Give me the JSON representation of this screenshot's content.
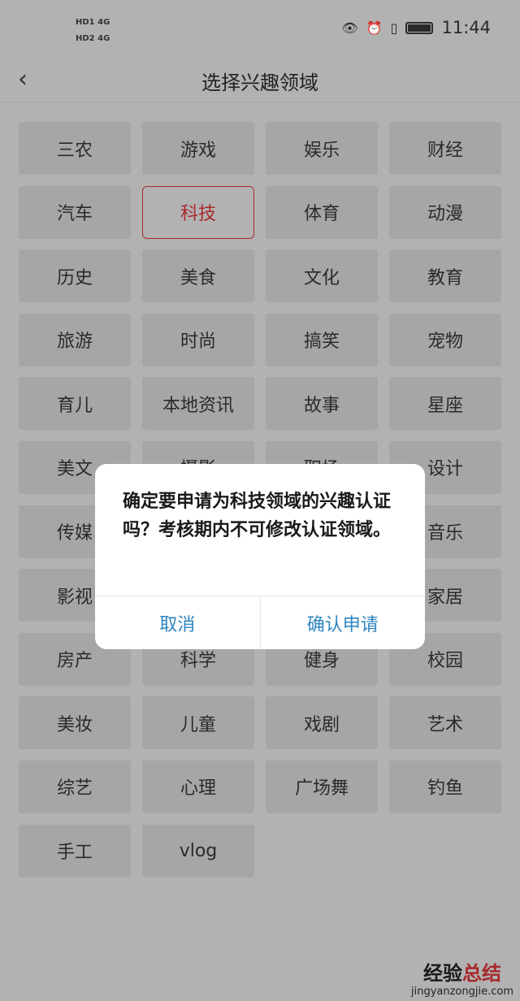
{
  "status_bar": {
    "left": [
      "HD1 4G",
      "HD2 4G"
    ],
    "time": "11:44",
    "icons": [
      "eye-icon",
      "alarm-icon",
      "vibrate-icon",
      "battery-icon"
    ]
  },
  "header": {
    "title": "选择兴趣领域",
    "back_icon": "chevron-left-icon"
  },
  "categories": [
    "三农",
    "游戏",
    "娱乐",
    "财经",
    "汽车",
    "科技",
    "体育",
    "动漫",
    "历史",
    "美食",
    "文化",
    "教育",
    "旅游",
    "时尚",
    "搞笑",
    "宠物",
    "育儿",
    "本地资讯",
    "故事",
    "星座",
    "美文",
    "摄影",
    "职场",
    "设计",
    "传媒",
    "",
    "",
    "音乐",
    "影视",
    "",
    "",
    "家居",
    "房产",
    "科学",
    "健身",
    "校园",
    "美妆",
    "儿童",
    "戏剧",
    "艺术",
    "综艺",
    "心理",
    "广场舞",
    "钓鱼",
    "手工",
    "vlog"
  ],
  "selected": "科技",
  "dialog": {
    "message": "确定要申请为科技领域的兴趣认证吗？考核期内不可修改认证领域。",
    "cancel": "取消",
    "confirm": "确认申请"
  },
  "watermark": {
    "brand": "经验总结",
    "url": "jingyanzongjie.com"
  },
  "colors": {
    "accent": "#a8292c",
    "button_text": "#2f86c0"
  }
}
